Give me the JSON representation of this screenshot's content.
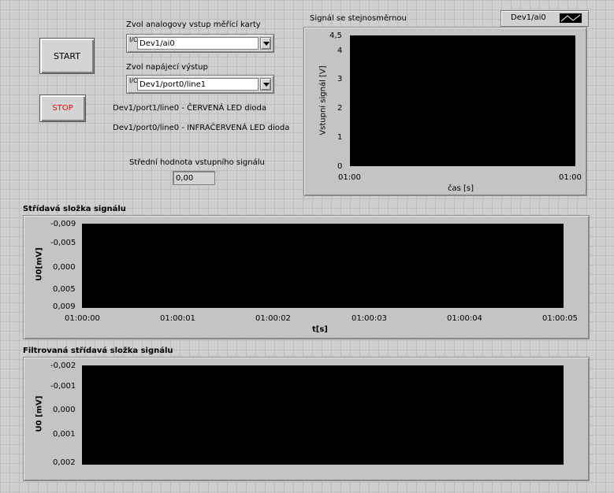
{
  "controls": {
    "start_label": "START",
    "stop_label": "STOP",
    "analog_input_label": "Zvol analogovy vstup měřící karty",
    "analog_input_value": "Dev1/ai0",
    "power_output_label": "Zvol napájecí výstup",
    "power_output_value": "Dev1/port0/line1",
    "io_glyph": "I/O",
    "led_red_text": "Dev1/port1/line0 - ČERVENÁ LED dioda",
    "led_ir_text": "Dev1/port0/line0 - INFRAČERVENÁ LED dioda",
    "mean_label": "Střední hodnota vstupního signálu",
    "mean_value": "0,00"
  },
  "colors": {
    "start_text": "#000000",
    "stop_text": "#ff0000",
    "plot_background": "#000000",
    "panel_background": "#c4c4c4"
  },
  "chart_data": [
    {
      "type": "line",
      "title": "Signál se stejnosměrnou",
      "legend": [
        "Dev1/ai0"
      ],
      "legend_position": "top-right",
      "xlabel": "čas [s]",
      "ylabel": "Vstupní signál [V]",
      "x_ticks": [
        "01:00",
        "01:00"
      ],
      "y_ticks": [
        "4,5",
        "4",
        "3",
        "2",
        "1",
        "0"
      ],
      "ylim": [
        0,
        4.5
      ],
      "series": []
    },
    {
      "type": "line",
      "title": "Střídavá složka signálu",
      "xlabel": "t[s]",
      "ylabel": "U0[mV]",
      "x_ticks": [
        "01:00:00",
        "01:00:01",
        "01:00:02",
        "01:00:03",
        "01:00:04",
        "01:00:05"
      ],
      "y_ticks": [
        "-0,009",
        "-0,005",
        "0,000",
        "0,005",
        "0,009"
      ],
      "ylim": [
        -0.009,
        0.009
      ],
      "series": []
    },
    {
      "type": "line",
      "title": "Filtrovaná střídavá složka signálu",
      "xlabel": "",
      "ylabel": "U0 [mV]",
      "y_ticks": [
        "-0,002",
        "-0,001",
        "0,000",
        "0,001",
        "0,002"
      ],
      "ylim": [
        -0.002,
        0.002
      ],
      "series": []
    }
  ]
}
